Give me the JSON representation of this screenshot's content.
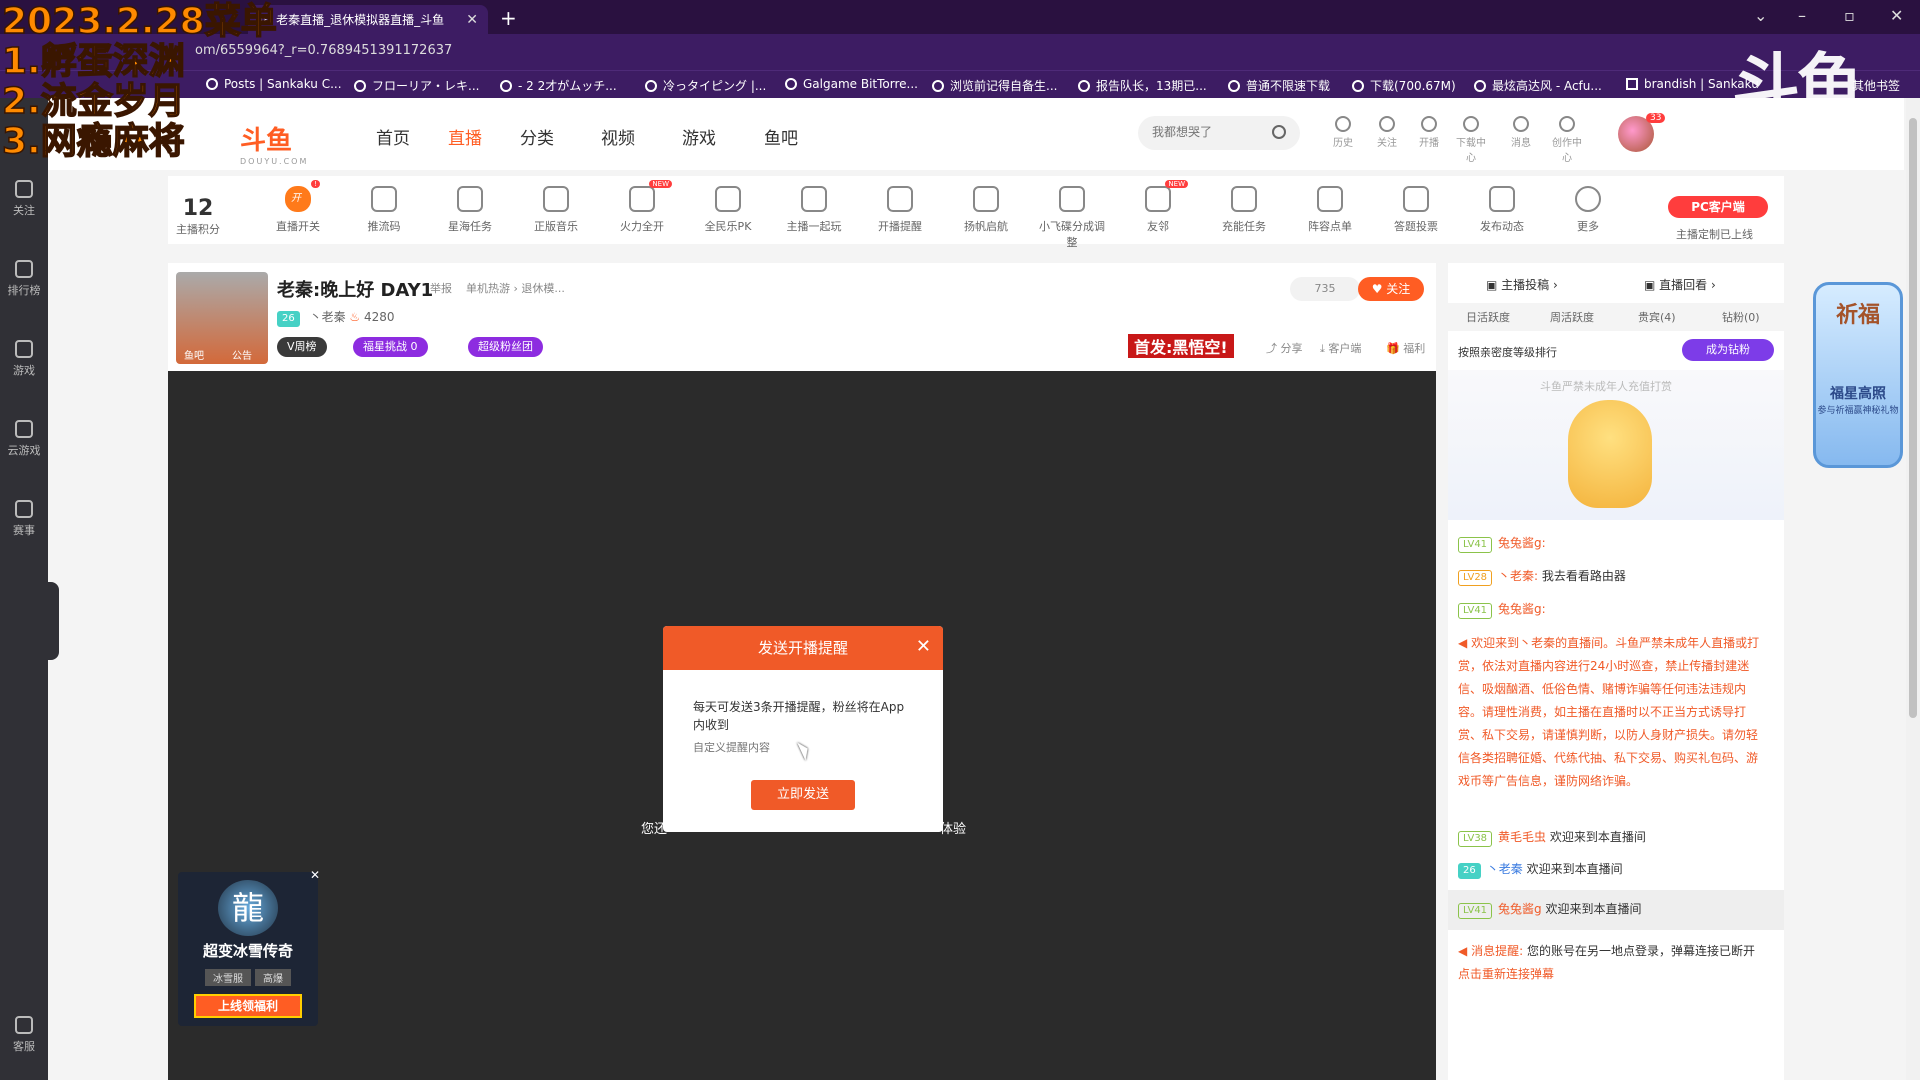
{
  "overlay": {
    "lines": [
      "2023.2.28菜单",
      "1.孵蛋深渊",
      "2.流金岁月",
      "3.网瘾麻将"
    ]
  },
  "browser": {
    "tab_title": "老秦直播_退休模拟器直播_斗鱼",
    "url": "om/6559964?_r=0.7689451391172637",
    "bookmarks": [
      "Posts | Sankaku C...",
      "フローリア・レキ...",
      "- 2 2才がムッチ...",
      "冷っタイピング |...",
      "Galgame BitTorre...",
      "浏览前记得自备生...",
      "报告队长，13期已...",
      "普通不限速下载",
      "下载(700.67M)",
      "最炫高达风 - Acfu...",
      "brandish | Sankaku"
    ],
    "bookmarks_right": "其他书签"
  },
  "brand": {
    "big_logo": "斗鱼",
    "site_logo": "斗鱼",
    "site_logo_sub": "DOUYU.COM"
  },
  "leftnav": [
    "关注",
    "排行榜",
    "游戏",
    "云游戏",
    "赛事",
    "客服"
  ],
  "header": {
    "nav": [
      "首页",
      "直播",
      "分类",
      "视频",
      "游戏",
      "鱼吧"
    ],
    "search_placeholder": "我都想哭了",
    "icons": [
      "历史",
      "关注",
      "开播",
      "下载中心",
      "消息",
      "创作中心"
    ],
    "avatar_badge": "33"
  },
  "tools": {
    "score_value": "12",
    "score_label": "主播积分",
    "items": [
      "直播开关",
      "推流码",
      "星海任务",
      "正版音乐",
      "火力全开",
      "全民乐PK",
      "主播一起玩",
      "开播提醒",
      "扬帆启航",
      "小飞碟分成调整",
      "友邻",
      "充能任务",
      "阵容点单",
      "答题投票",
      "发布动态",
      "更多"
    ],
    "toggle_label": "开",
    "badge": "!",
    "new_badge": "NEW",
    "pc_client": "PC客户端",
    "pc_sub": "主播定制已上线"
  },
  "room": {
    "title": "老秦:晚上好 DAY1",
    "report": "举报",
    "category": "单机热游 › 退休模...",
    "thumb_tags": [
      "鱼吧",
      "公告"
    ],
    "level": "26",
    "owner": "丶老秦",
    "heat": "4280",
    "pills": [
      "V周榜",
      "福星挑战",
      "0",
      "超级粉丝团"
    ],
    "viewers": "735",
    "follow": "关注",
    "black_myth": "首发:黑悟空!",
    "actions": [
      "分享",
      "客户端",
      "福利"
    ]
  },
  "video": {
    "hint_left": "您还",
    "hint_right": "体验"
  },
  "modal": {
    "title": "发送开播提醒",
    "body": "每天可发送3条开播提醒，粉丝将在App内收到",
    "placeholder": "自定义提醒内容",
    "button": "立即发送"
  },
  "ad": {
    "logo": "龍",
    "title": "超变冰雪传奇",
    "tags": [
      "冰雪服",
      "高爆"
    ],
    "button": "上线领福利"
  },
  "rightpanel": {
    "top": [
      "主播投稿",
      "直播回看"
    ],
    "tabs": [
      "日活跃度",
      "周活跃度",
      "贵宾(4)",
      "钻粉(0)"
    ],
    "rank_label": "按照亲密度等级排行",
    "fan_button": "成为钻粉",
    "mascot_note": "斗鱼严禁未成年人充值打赏",
    "messages": [
      {
        "lvl": "LV41",
        "user": "兔兔酱g:",
        "text": ""
      },
      {
        "lvl": "LV28",
        "user": "丶老秦:",
        "text": "我去看看路由器"
      },
      {
        "lvl": "LV41",
        "user": "兔兔酱g:",
        "text": ""
      }
    ],
    "notice": "欢迎来到丶老秦的直播间。斗鱼严禁未成年人直播或打赏，依法对直播内容进行24小时巡查，禁止传播封建迷信、吸烟酗酒、低俗色情、赌博诈骗等任何违法违规内容。请理性消费，如主播在直播时以不正当方式诱导打赏、私下交易，请谨慎判断，以防人身财产损失。请勿轻信各类招聘征婚、代练代抽、私下交易、购买礼包码、游戏币等广告信息，谨防网络诈骗。",
    "welcomes": [
      {
        "lvl": "LV38",
        "user": "黄毛毛虫",
        "text": "欢迎来到本直播间"
      },
      {
        "lvl": "26",
        "user": "丶老秦",
        "text": "欢迎来到本直播间"
      },
      {
        "lvl": "LV41",
        "user": "兔兔酱g",
        "text": "欢迎来到本直播间"
      }
    ],
    "reconnect_label": "消息提醒:",
    "reconnect": "您的账号在另一地点登录，弹幕连接已断开",
    "reconnect_link": "点击重新连接弹幕"
  },
  "promo": {
    "title": "祈福",
    "sub": "福星高照",
    "note": "参与祈福赢神秘礼物"
  }
}
